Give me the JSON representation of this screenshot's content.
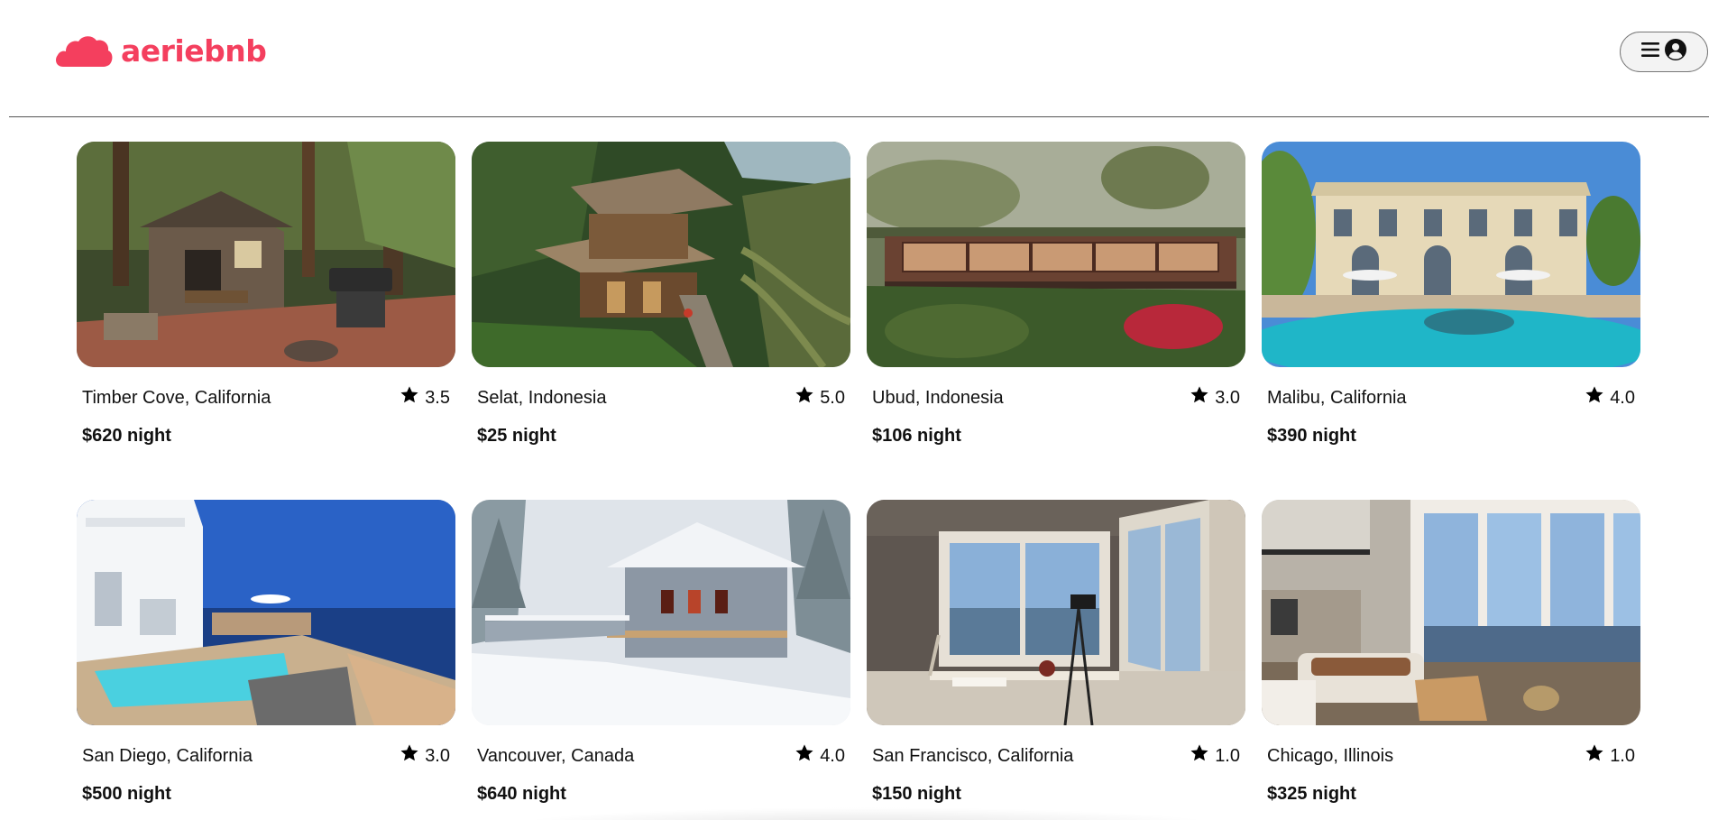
{
  "brand": {
    "name": "aeriebnb",
    "color": "#f43f5e"
  },
  "header": {
    "menu_icon": "hamburger-icon",
    "user_icon": "user-avatar-icon"
  },
  "listings": [
    {
      "location": "Timber Cove, California",
      "rating": "3.5",
      "price": "$620 night",
      "scene": "forest-deck"
    },
    {
      "location": "Selat, Indonesia",
      "rating": "5.0",
      "price": "$25 night",
      "scene": "jungle-hut"
    },
    {
      "location": "Ubud, Indonesia",
      "rating": "3.0",
      "price": "$106 night",
      "scene": "jungle-glasshouse"
    },
    {
      "location": "Malibu, California",
      "rating": "4.0",
      "price": "$390 night",
      "scene": "mansion-pool"
    },
    {
      "location": "San Diego, California",
      "rating": "3.0",
      "price": "$500 night",
      "scene": "ocean-pool"
    },
    {
      "location": "Vancouver, Canada",
      "rating": "4.0",
      "price": "$640 night",
      "scene": "snow-cabin"
    },
    {
      "location": "San Francisco, California",
      "rating": "1.0",
      "price": "$150 night",
      "scene": "window-desk"
    },
    {
      "location": "Chicago, Illinois",
      "rating": "1.0",
      "price": "$325 night",
      "scene": "loft-living"
    }
  ]
}
